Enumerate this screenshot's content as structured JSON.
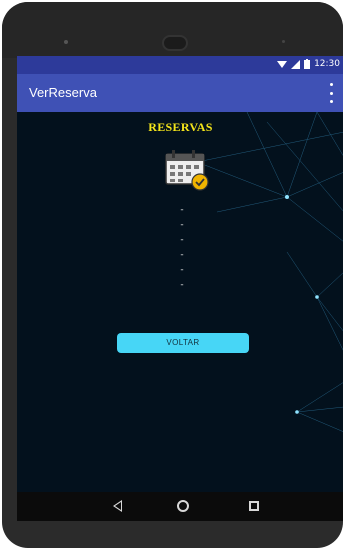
{
  "status_bar": {
    "time": "12:30"
  },
  "app_bar": {
    "title": "VerReserva",
    "menu_icon": "overflow-menu-icon"
  },
  "content": {
    "heading": "RESERVAS",
    "icon": "calendar-icon",
    "placeholder_lines": [
      "-",
      "-",
      "-",
      "-",
      "-",
      "-"
    ],
    "back_button_label": "VOLTAR"
  },
  "nav_bar": {
    "back_icon": "back-icon",
    "home_icon": "home-icon",
    "recents_icon": "recents-icon"
  },
  "colors": {
    "app_bar": "#3f51b5",
    "status_bar": "#2d3a9a",
    "heading": "#f5e51a",
    "button": "#47d6f6",
    "background": "#03111d"
  }
}
